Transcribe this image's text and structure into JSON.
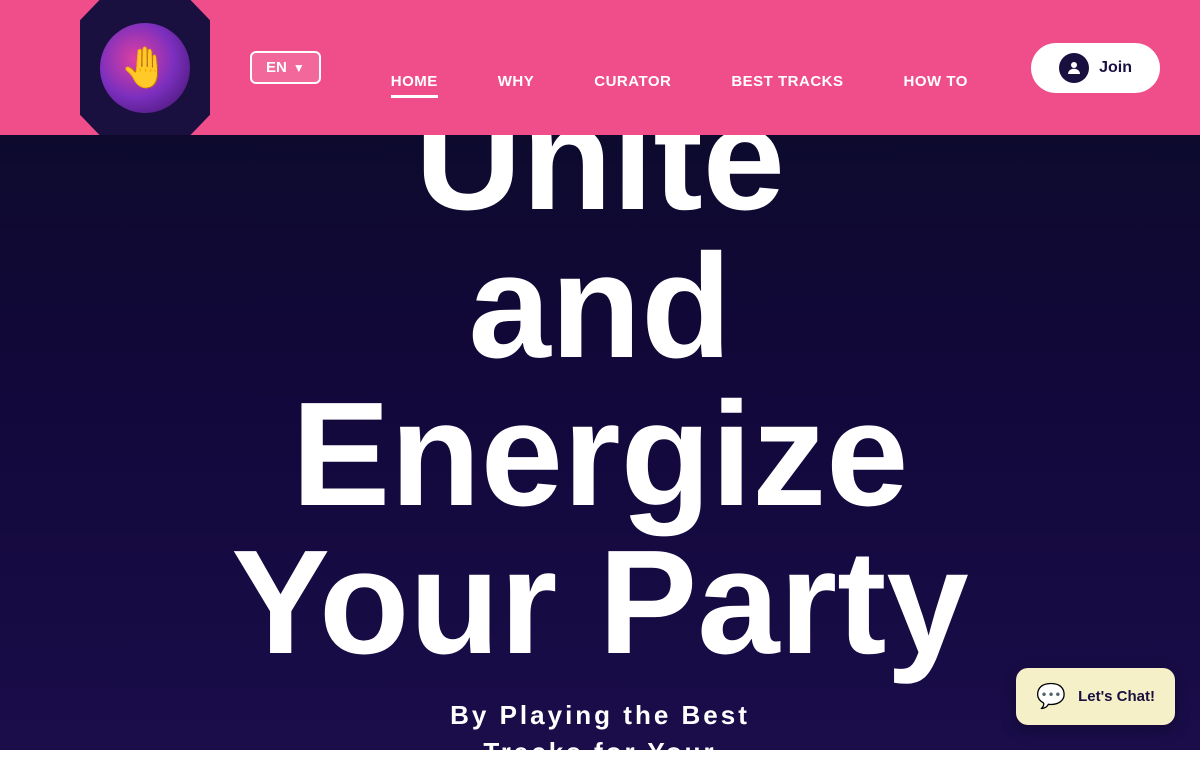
{
  "header": {
    "logo_icon": "🤚",
    "lang_label": "EN",
    "nav": [
      {
        "id": "home",
        "label": "HOME",
        "active": true
      },
      {
        "id": "why",
        "label": "WHY",
        "active": false
      },
      {
        "id": "curator",
        "label": "CURATOR",
        "active": false
      },
      {
        "id": "best-tracks",
        "label": "BEST TRACKS",
        "active": false
      },
      {
        "id": "how-to",
        "label": "HOW TO",
        "active": false
      }
    ],
    "join_button": "Join",
    "user_icon": "👤"
  },
  "hero": {
    "title_line1": "Unite",
    "title_line2": "and",
    "title_line3": "Energize",
    "title_line4": "Your Party",
    "subtitle_line1": "By Playing the Best",
    "subtitle_line2": "Tracks for Your"
  },
  "chat": {
    "icon": "💬",
    "label": "Let's Chat!"
  },
  "colors": {
    "header_bg": "#f04e8a",
    "hero_bg": "#0d0a2e",
    "text_white": "#ffffff",
    "logo_bg": "#1a1040"
  }
}
